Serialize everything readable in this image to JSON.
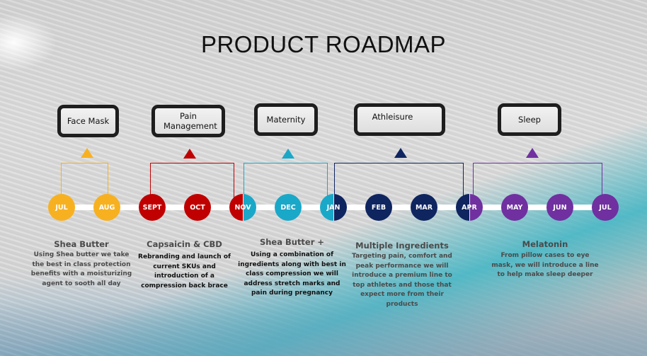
{
  "title": "PRODUCT ROADMAP",
  "colors": {
    "face_mask": "#f7b120",
    "pain_management": "#c00000",
    "maternity": "#1aa8c8",
    "athleisure": "#0e2560",
    "sleep": "#7030a0"
  },
  "categories": [
    {
      "label": "Face Mask",
      "color": "#f7b120"
    },
    {
      "label": "Pain Management",
      "color": "#c00000"
    },
    {
      "label": "Maternity",
      "color": "#1aa8c8"
    },
    {
      "label": "Athleisure",
      "color": "#0e2560"
    },
    {
      "label": "Sleep",
      "color": "#7030a0"
    }
  ],
  "months": [
    {
      "label": "JUL",
      "color": "#f7b120"
    },
    {
      "label": "AUG",
      "color": "#f7b120"
    },
    {
      "label": "SEPT",
      "color": "#c00000"
    },
    {
      "label": "OCT",
      "color": "#c00000"
    },
    {
      "label": "NOV",
      "color_left": "#c00000",
      "color_right": "#1aa8c8"
    },
    {
      "label": "DEC",
      "color": "#1aa8c8"
    },
    {
      "label": "JAN",
      "color_left": "#1aa8c8",
      "color_right": "#0e2560"
    },
    {
      "label": "FEB",
      "color": "#0e2560"
    },
    {
      "label": "MAR",
      "color": "#0e2560"
    },
    {
      "label": "APR",
      "color_left": "#0e2560",
      "color_right": "#7030a0"
    },
    {
      "label": "MAY",
      "color": "#7030a0"
    },
    {
      "label": "JUN",
      "color": "#7030a0"
    },
    {
      "label": "JUL",
      "color": "#7030a0"
    }
  ],
  "descriptions": [
    {
      "heading": "Shea Butter",
      "lines": [
        "Using Shea butter we take",
        "the best in class protection",
        "benefits with a moisturizing",
        "agent to sooth all day"
      ]
    },
    {
      "heading": "Capsaicin & CBD",
      "lines": [
        "Rebranding and launch of",
        "current SKUs and",
        "introduction of a",
        "compression  back brace"
      ]
    },
    {
      "heading": "Shea Butter +",
      "lines": [
        "Using a combination of",
        "ingredients along with best in",
        "class compression we will",
        "address stretch marks and",
        "pain during pregnancy"
      ]
    },
    {
      "heading": "Multiple Ingredients",
      "lines": [
        "Targeting pain, comfort and",
        "peak performance we will",
        "introduce a premium line to",
        "top athletes and those that",
        "expect more from their",
        "products"
      ]
    },
    {
      "heading": "Melatonin",
      "lines": [
        "From pillow cases to eye",
        "mask, we will introduce a line",
        "to help make sleep deeper"
      ]
    }
  ]
}
